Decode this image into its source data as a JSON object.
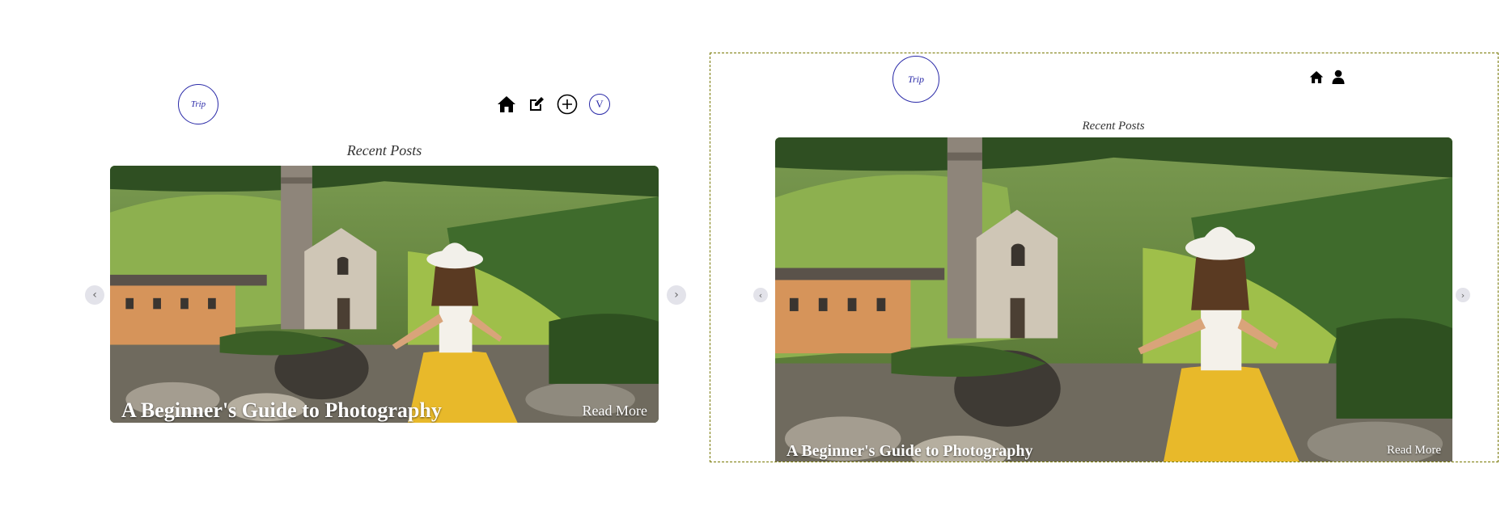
{
  "brand": {
    "logo_text": "Trip"
  },
  "home": {
    "section_title": "Recent Posts"
  },
  "slide": {
    "title": "A Beginner's Guide to Photography",
    "read_more": "Read More"
  },
  "nav_left": {
    "items": [
      "home-icon",
      "edit-icon",
      "add-icon",
      "avatar"
    ],
    "avatar_initial": "V"
  },
  "nav_right": {
    "items": [
      "home-icon",
      "user-icon"
    ]
  },
  "carousel": {
    "prev_glyph": "‹",
    "next_glyph": "›"
  },
  "colors": {
    "accent": "#2a2aa8",
    "dress": "#e8b92a",
    "hat": "#f2f0ea"
  }
}
